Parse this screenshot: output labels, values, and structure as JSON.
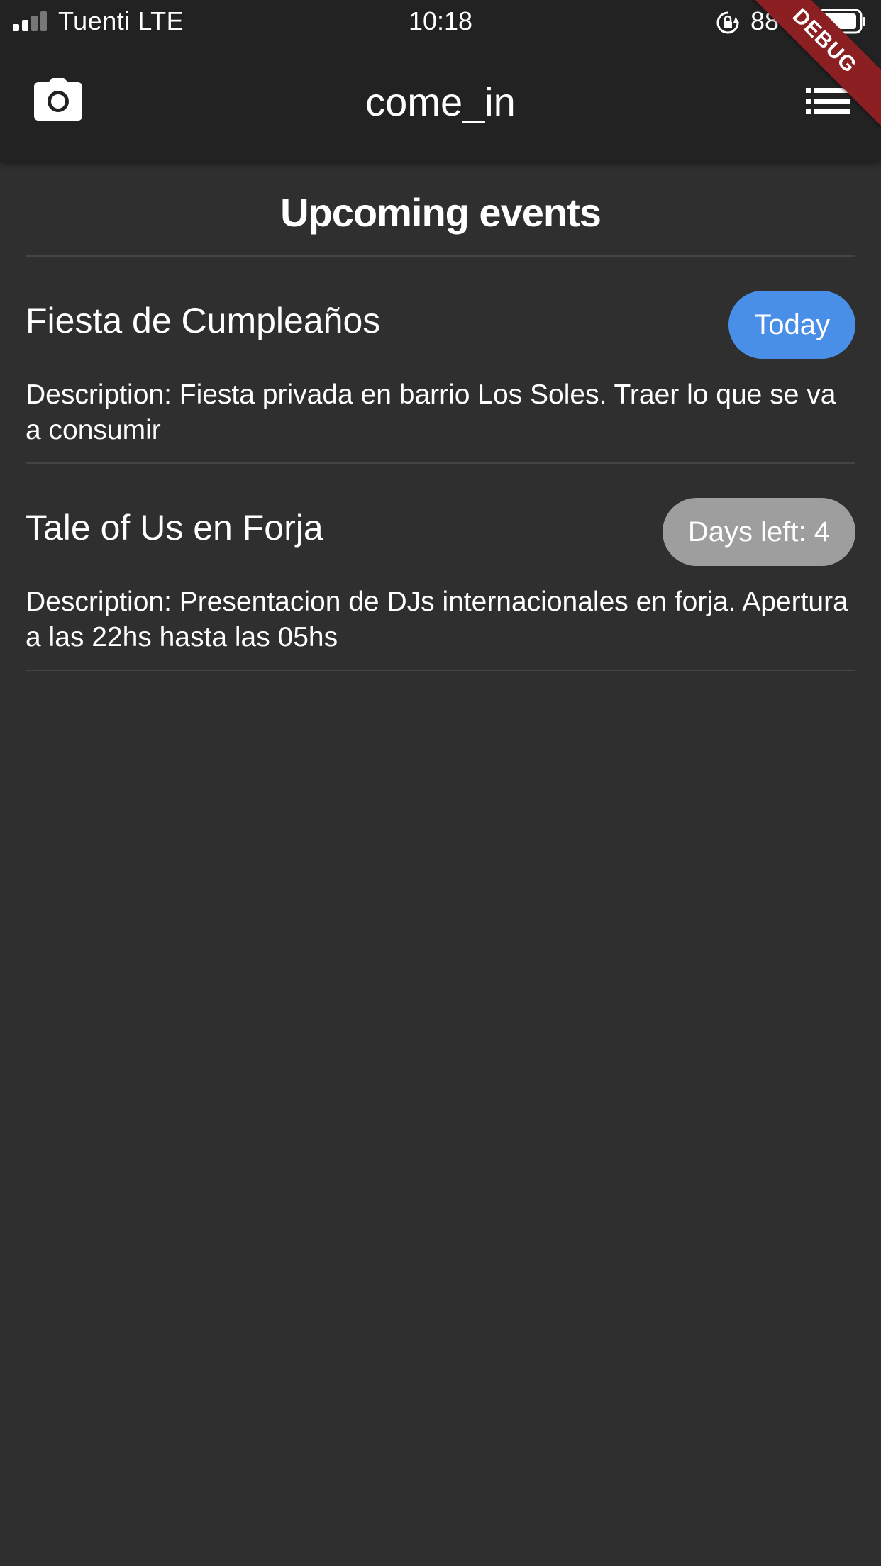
{
  "status_bar": {
    "carrier": "Tuenti",
    "network": "LTE",
    "time": "10:18",
    "battery": "88 %",
    "signal_bars_filled": 2,
    "signal_bars_total": 4
  },
  "app_bar": {
    "title": "come_in",
    "left_icon": "camera-icon",
    "right_icon": "list-icon"
  },
  "debug_banner": "DEBUG",
  "section": {
    "title": "Upcoming events"
  },
  "events": [
    {
      "name": "Fiesta de Cumpleaños",
      "badge": "Today",
      "description": "Description: Fiesta privada en barrio Los Soles. Traer lo que se va a consumir"
    },
    {
      "name": "Tale of Us en Forja",
      "badge": "Days left: 4",
      "description": "Description: Presentacion de DJs internacionales en forja. Apertura a las 22hs hasta las 05hs"
    }
  ],
  "colors": {
    "background": "#2f2f2f",
    "app_bar": "#222222",
    "badge_today": "#4a8fe7",
    "badge_upcoming": "#9e9e9e",
    "debug": "#8b1f22",
    "divider": "#444444"
  }
}
